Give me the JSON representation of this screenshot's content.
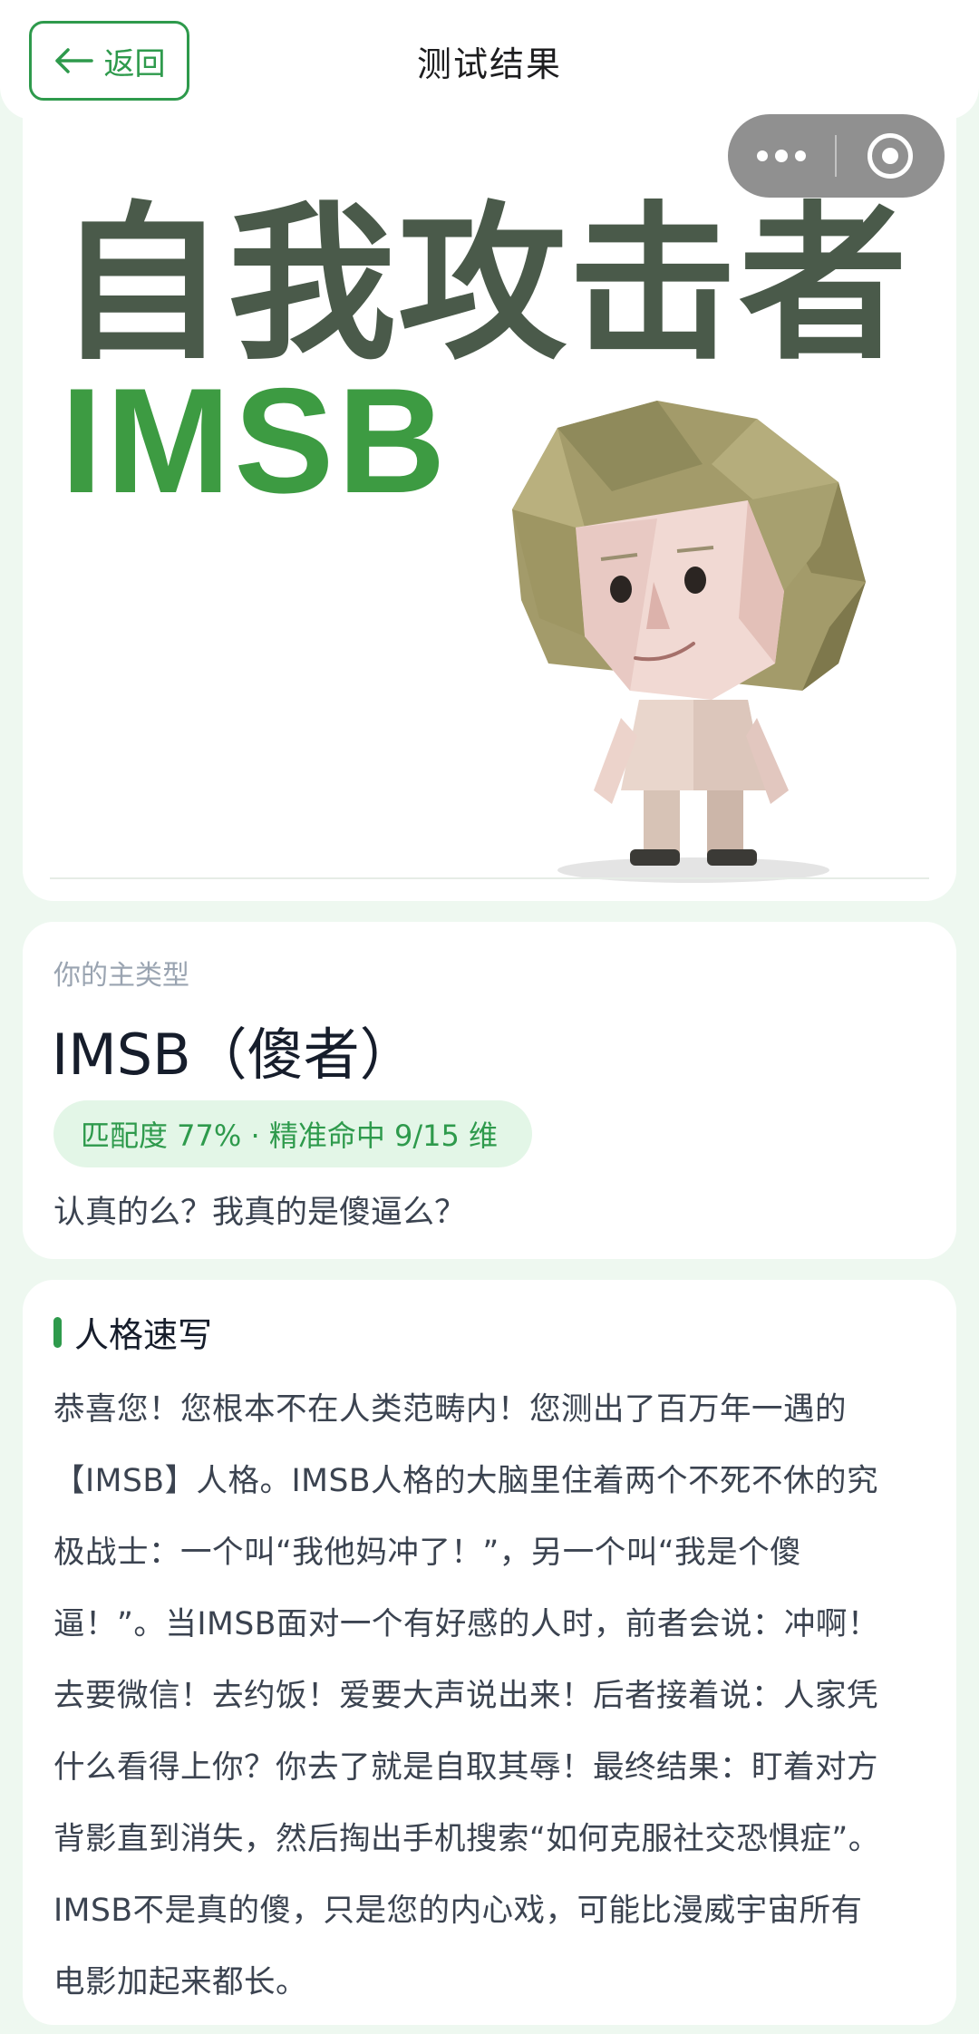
{
  "header": {
    "back_label": "返回",
    "title": "测试结果"
  },
  "hero": {
    "title": "自我攻击者",
    "code": "IMSB"
  },
  "result": {
    "label": "你的主类型",
    "type_name": "IMSB（傻者）",
    "badge": "匹配度 77% · 精准命中 9/15 维",
    "quote": "认真的么？我真的是傻逼么？"
  },
  "portrait": {
    "title": "人格速写",
    "text": "恭喜您！您根本不在人类范畴内！您测出了百万年一遇的【IMSB】人格。IMSB人格的大脑里住着两个不死不休的究极战士：一个叫“我他妈冲了！”，另一个叫“我是个傻逼！”。当IMSB面对一个有好感的人时，前者会说：冲啊！去要微信！去约饭！爱要大声说出来！后者接着说：人家凭什么看得上你？你去了就是自取其辱！最终结果：盯着对方背影直到消失，然后掏出手机搜索“如何克服社交恐惧症”。IMSB不是真的傻，只是您的内心戏，可能比漫威宇宙所有电影加起来都长。"
  },
  "colors": {
    "accent": "#2e9a4c",
    "background": "#eef8f0",
    "badge_bg": "#e3f6e7"
  },
  "icons": {
    "back": "arrow-left-icon",
    "capsule_more": "more-dots-icon",
    "capsule_close": "target-close-icon"
  }
}
